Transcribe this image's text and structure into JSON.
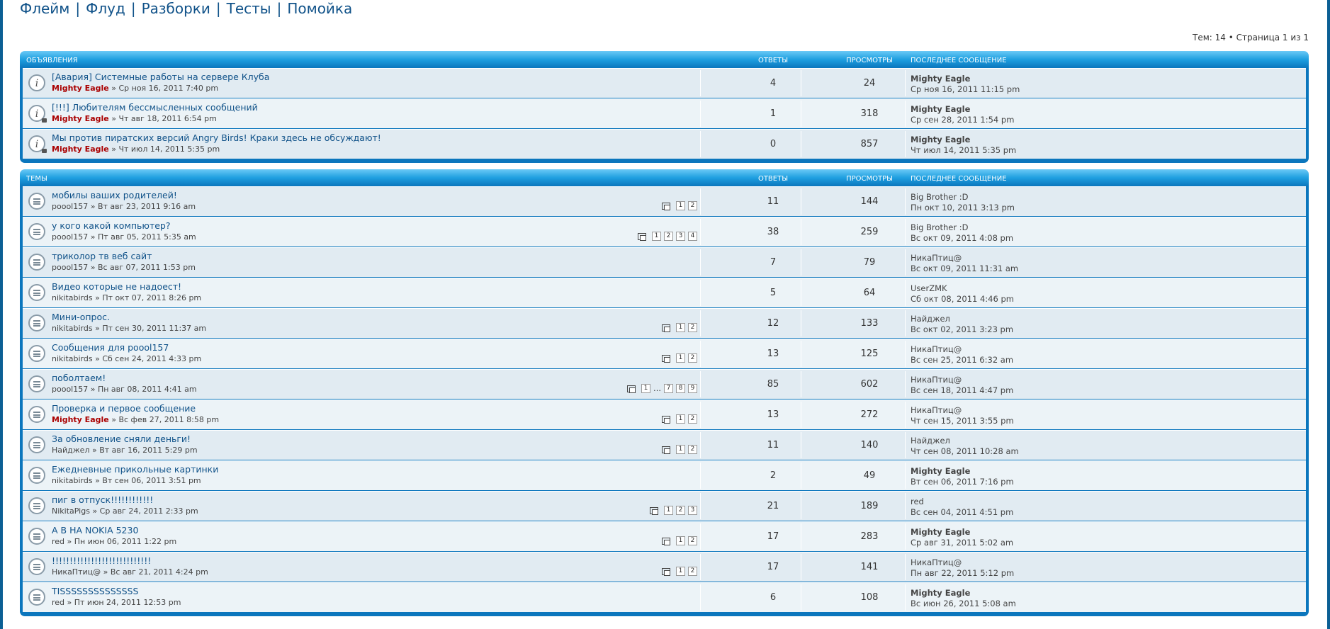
{
  "nav": [
    "Флейм",
    "Флуд",
    "Разборки",
    "Тесты",
    "Помойка"
  ],
  "pagination": "Тем: 14 • Страница 1 из 1",
  "columns": {
    "replies": "ОТВЕТЫ",
    "views": "ПРОСМОТРЫ",
    "last": "ПОСЛЕДНЕЕ СООБЩЕНИЕ"
  },
  "sections": [
    {
      "title": "ОБЪЯВЛЕНИЯ",
      "icon": "announcement-icon",
      "topics": [
        {
          "title": "[Авария] Системные работы на сервере Клуба",
          "author": "Mighty Eagle",
          "admin": true,
          "date": "» Ср ноя 16, 2011 7:40 pm",
          "pages": [],
          "replies": "4",
          "views": "24",
          "last_author": "Mighty Eagle",
          "last_admin": true,
          "last_date": "Ср ноя 16, 2011 11:15 pm",
          "locked": false
        },
        {
          "title": "[!!!] Любителям бессмысленных сообщений",
          "author": "Mighty Eagle",
          "admin": true,
          "date": "» Чт авг 18, 2011 6:54 pm",
          "pages": [],
          "replies": "1",
          "views": "318",
          "last_author": "Mighty Eagle",
          "last_admin": true,
          "last_date": "Ср сен 28, 2011 1:54 pm",
          "locked": true
        },
        {
          "title": "Мы против пиратских версий Angry Birds! Краки здесь не обсуждают!",
          "author": "Mighty Eagle",
          "admin": true,
          "date": "» Чт июл 14, 2011 5:35 pm",
          "pages": [],
          "replies": "0",
          "views": "857",
          "last_author": "Mighty Eagle",
          "last_admin": true,
          "last_date": "Чт июл 14, 2011 5:35 pm",
          "locked": true
        }
      ]
    },
    {
      "title": "ТЕМЫ",
      "icon": "topic-icon",
      "topics": [
        {
          "title": "мобилы ваших родителей!",
          "author": "poool157",
          "admin": false,
          "date": "» Вт авг 23, 2011 9:16 am",
          "pages": [
            "1",
            "2"
          ],
          "replies": "11",
          "views": "144",
          "last_author": "Big Brother :D",
          "last_admin": false,
          "last_date": "Пн окт 10, 2011 3:13 pm"
        },
        {
          "title": "у кого какой компьютер?",
          "author": "poool157",
          "admin": false,
          "date": "» Пт авг 05, 2011 5:35 am",
          "pages": [
            "1",
            "2",
            "3",
            "4"
          ],
          "replies": "38",
          "views": "259",
          "last_author": "Big Brother :D",
          "last_admin": false,
          "last_date": "Вс окт 09, 2011 4:08 pm"
        },
        {
          "title": "триколор тв веб сайт",
          "author": "poool157",
          "admin": false,
          "date": "» Вс авг 07, 2011 1:53 pm",
          "pages": [],
          "replies": "7",
          "views": "79",
          "last_author": "НикаПтиц@",
          "last_admin": false,
          "last_date": "Вс окт 09, 2011 11:31 am"
        },
        {
          "title": "Видео которые не надоест!",
          "author": "nikitabirds",
          "admin": false,
          "date": "» Пт окт 07, 2011 8:26 pm",
          "pages": [],
          "replies": "5",
          "views": "64",
          "last_author": "UserZMK",
          "last_admin": false,
          "last_date": "Сб окт 08, 2011 4:46 pm"
        },
        {
          "title": "Мини-опрос.",
          "author": "nikitabirds",
          "admin": false,
          "date": "» Пт сен 30, 2011 11:37 am",
          "pages": [
            "1",
            "2"
          ],
          "replies": "12",
          "views": "133",
          "last_author": "Найджел",
          "last_admin": false,
          "last_date": "Вс окт 02, 2011 3:23 pm"
        },
        {
          "title": "Сообщения для poool157",
          "author": "nikitabirds",
          "admin": false,
          "date": "» Сб сен 24, 2011 4:33 pm",
          "pages": [
            "1",
            "2"
          ],
          "replies": "13",
          "views": "125",
          "last_author": "НикаПтиц@",
          "last_admin": false,
          "last_date": "Вс сен 25, 2011 6:32 am"
        },
        {
          "title": "поболтаем!",
          "author": "poool157",
          "admin": false,
          "date": "» Пн авг 08, 2011 4:41 am",
          "pages": [
            "1",
            "…",
            "7",
            "8",
            "9"
          ],
          "replies": "85",
          "views": "602",
          "last_author": "НикаПтиц@",
          "last_admin": false,
          "last_date": "Вс сен 18, 2011 4:47 pm"
        },
        {
          "title": "Проверка и первое сообщение",
          "author": "Mighty Eagle",
          "admin": true,
          "date": "» Вс фев 27, 2011 8:58 pm",
          "pages": [
            "1",
            "2"
          ],
          "replies": "13",
          "views": "272",
          "last_author": "НикаПтиц@",
          "last_admin": false,
          "last_date": "Чт сен 15, 2011 3:55 pm"
        },
        {
          "title": "За обновление сняли деньги!",
          "author": "Найджел",
          "admin": false,
          "date": "» Вт авг 16, 2011 5:29 pm",
          "pages": [
            "1",
            "2"
          ],
          "replies": "11",
          "views": "140",
          "last_author": "Найджел",
          "last_admin": false,
          "last_date": "Чт сен 08, 2011 10:28 am"
        },
        {
          "title": "Ежедневные прикольные картинки",
          "author": "nikitabirds",
          "admin": false,
          "date": "» Вт сен 06, 2011 3:51 pm",
          "pages": [],
          "replies": "2",
          "views": "49",
          "last_author": "Mighty Eagle",
          "last_admin": true,
          "last_date": "Вт сен 06, 2011 7:16 pm"
        },
        {
          "title": "пиг в отпуск!!!!!!!!!!!!",
          "author": "NikitaPigs",
          "admin": false,
          "date": "» Ср авг 24, 2011 2:33 pm",
          "pages": [
            "1",
            "2",
            "3"
          ],
          "replies": "21",
          "views": "189",
          "last_author": "red",
          "last_admin": false,
          "last_date": "Вс сен 04, 2011 4:51 pm"
        },
        {
          "title": "А В НА NOKIA 5230",
          "author": "red",
          "admin": false,
          "date": "» Пн июн 06, 2011 1:22 pm",
          "pages": [
            "1",
            "2"
          ],
          "replies": "17",
          "views": "283",
          "last_author": "Mighty Eagle",
          "last_admin": true,
          "last_date": "Ср авг 31, 2011 5:02 am"
        },
        {
          "title": "!!!!!!!!!!!!!!!!!!!!!!!!!!!!",
          "author": "НикаПтиц@",
          "admin": false,
          "date": "» Вс авг 21, 2011 4:24 pm",
          "pages": [
            "1",
            "2"
          ],
          "replies": "17",
          "views": "141",
          "last_author": "НикаПтиц@",
          "last_admin": false,
          "last_date": "Пн авг 22, 2011 5:12 pm"
        },
        {
          "title": "TISSSSSSSSSSSSSS",
          "author": "red",
          "admin": false,
          "date": "» Пт июн 24, 2011 12:53 pm",
          "pages": [],
          "replies": "6",
          "views": "108",
          "last_author": "Mighty Eagle",
          "last_admin": true,
          "last_date": "Вс июн 26, 2011 5:08 am"
        }
      ]
    }
  ]
}
